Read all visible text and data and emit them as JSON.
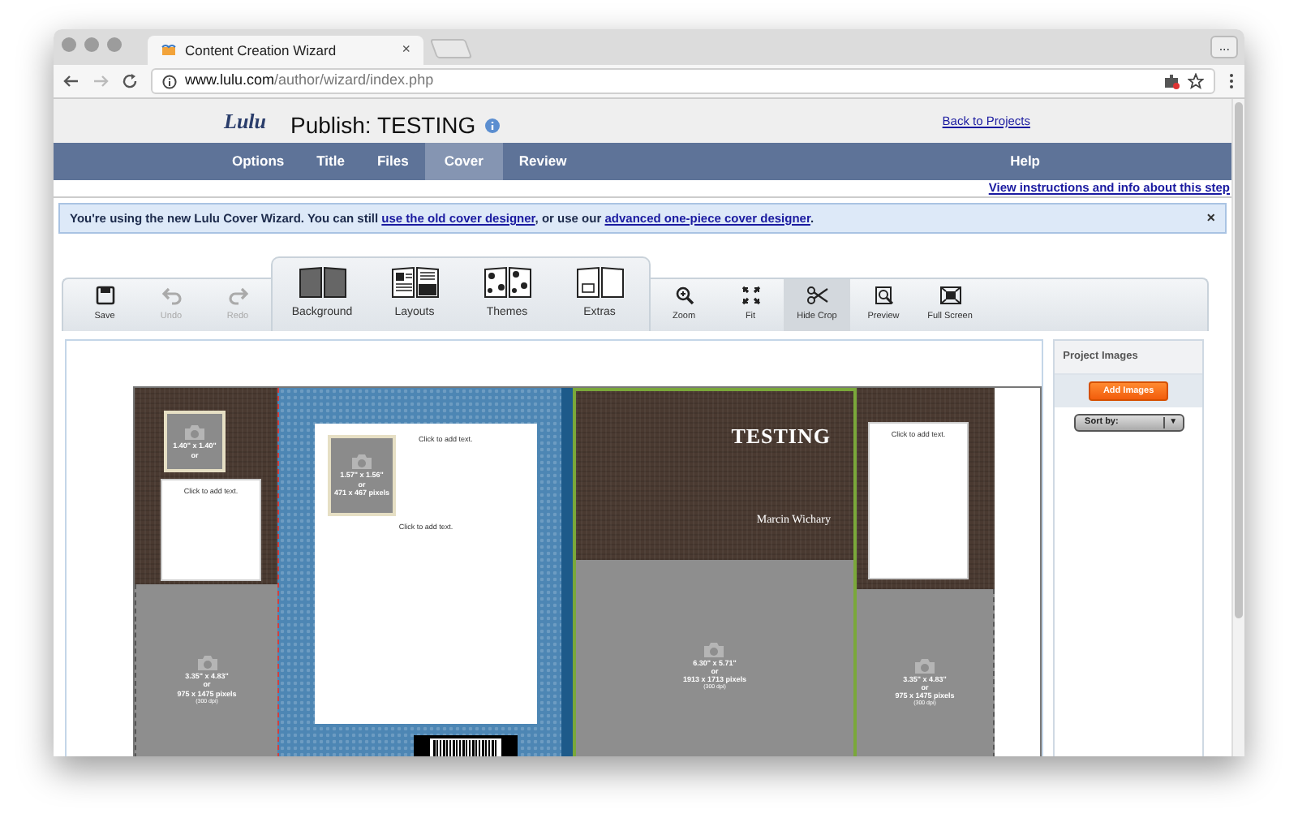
{
  "browser": {
    "tab_title": "Content Creation Wizard",
    "tab_close": "×",
    "more": "...",
    "url_host": "www.lulu.com",
    "url_path": "/author/wizard/index.php"
  },
  "header": {
    "logo": "Lulu",
    "title": "Publish: TESTING",
    "back_link": "Back to Projects"
  },
  "nav": [
    {
      "label": "Options",
      "selected": false
    },
    {
      "label": "Title",
      "selected": false
    },
    {
      "label": "Files",
      "selected": false
    },
    {
      "label": "Cover",
      "selected": true
    },
    {
      "label": "Review",
      "selected": false
    },
    {
      "label": "Help",
      "selected": false
    }
  ],
  "help_link": "View instructions and info about this step",
  "notice": {
    "text": "You're using the new Lulu Cover Wizard. You can still ",
    "link1": "use the old cover designer",
    "middle": ", or use our ",
    "link2": "advanced one-piece cover designer",
    "end": ".",
    "close": "×"
  },
  "tools_left": [
    {
      "label": "Save",
      "kind": "save",
      "disabled": false,
      "pressed": false
    },
    {
      "label": "Undo",
      "kind": "undo",
      "disabled": true,
      "pressed": false
    },
    {
      "label": "Redo",
      "kind": "redo",
      "disabled": true,
      "pressed": false
    }
  ],
  "design_tabs": [
    {
      "label": "Background",
      "kind": "background"
    },
    {
      "label": "Layouts",
      "kind": "layouts"
    },
    {
      "label": "Themes",
      "kind": "themes"
    },
    {
      "label": "Extras",
      "kind": "extras"
    }
  ],
  "tools_right": [
    {
      "label": "Zoom",
      "kind": "zoom",
      "disabled": false,
      "pressed": false
    },
    {
      "label": "Fit",
      "kind": "fit",
      "disabled": false,
      "pressed": false
    },
    {
      "label": "Hide Crop",
      "kind": "crop",
      "disabled": false,
      "pressed": true
    },
    {
      "label": "Preview",
      "kind": "preview",
      "disabled": false,
      "pressed": false
    },
    {
      "label": "Full Screen",
      "kind": "fullscreen",
      "disabled": false,
      "pressed": false
    }
  ],
  "cover": {
    "left_flap": {
      "photo": {
        "size": "1.40\" x 1.40\"",
        "or": "or"
      },
      "text_box": "Click to add text.",
      "image_slot": {
        "size": "3.35\" x 4.83\"",
        "or": "or",
        "pixels": "975 x 1475 pixels",
        "dpi": "(300 dpi)"
      }
    },
    "back": {
      "photo": {
        "size": "1.57\" x 1.56\"",
        "or": "or",
        "pixels": "471 x 467 pixels"
      },
      "heading_text": "Click to add text.",
      "body_text": "Click to add text."
    },
    "front": {
      "title": "TESTING",
      "author": "Marcin Wichary",
      "image_slot": {
        "size": "6.30\" x 5.71\"",
        "or": "or",
        "pixels": "1913 x 1713 pixels",
        "dpi": "(300 dpi)"
      }
    },
    "right_flap": {
      "text_box": "Click to add text.",
      "image_slot": {
        "size": "3.35\" x 4.83\"",
        "or": "or",
        "pixels": "975 x 1475 pixels",
        "dpi": "(300 dpi)"
      }
    }
  },
  "panel": {
    "title": "Project Images",
    "button": "Add Images",
    "sort_label": "Sort by:",
    "sort_caret": "▼"
  }
}
